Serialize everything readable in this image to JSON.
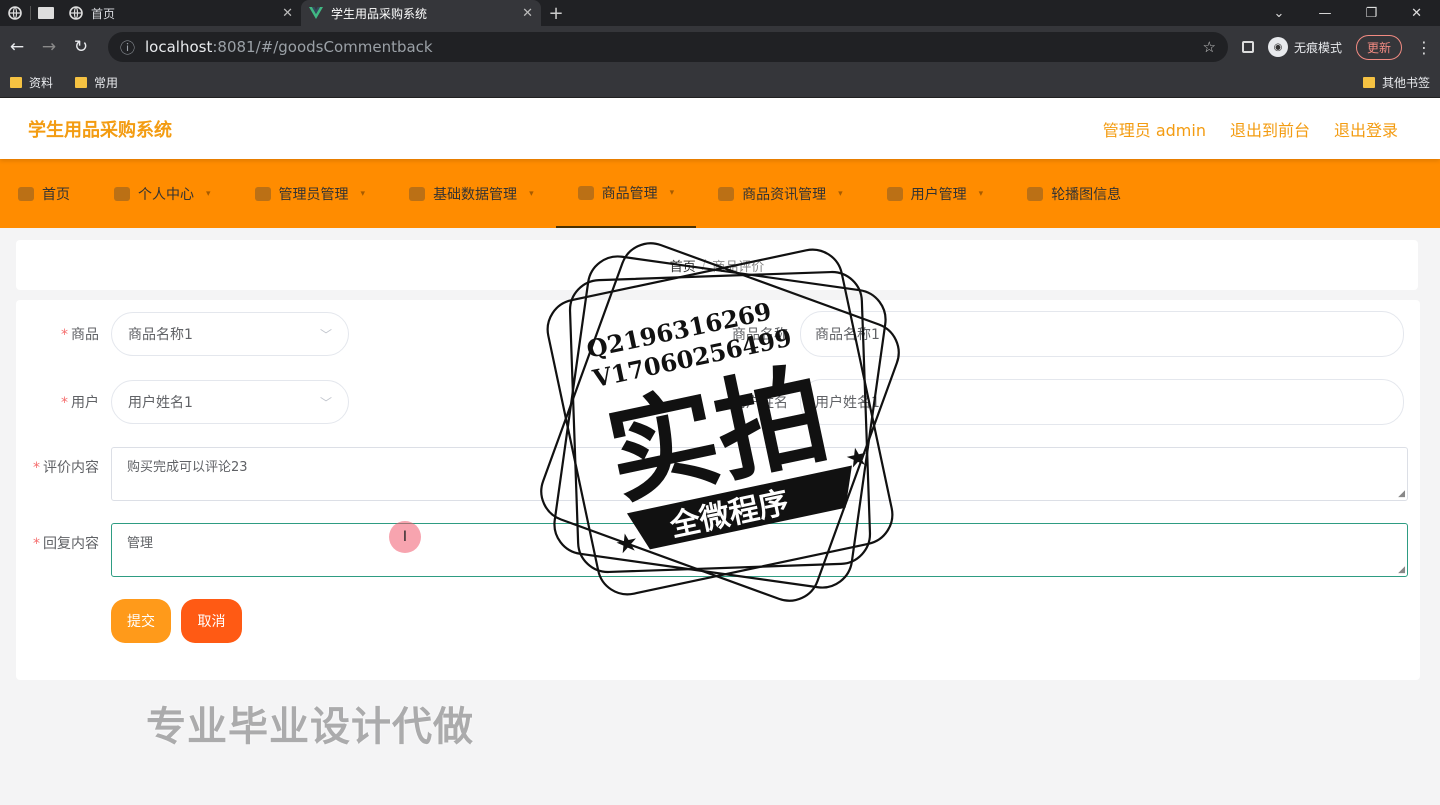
{
  "browser": {
    "tabs": [
      {
        "title": "首页",
        "active": false
      },
      {
        "title": "学生用品采购系统",
        "active": true
      }
    ],
    "url_host": "localhost",
    "url_rest": ":8081/#/goodsCommentback",
    "incognito_label": "无痕模式",
    "update_label": "更新",
    "bookmarks": [
      "资料",
      "常用"
    ],
    "other_bookmarks": "其他书签"
  },
  "header": {
    "title": "学生用品采购系统",
    "links": [
      "管理员 admin",
      "退出到前台",
      "退出登录"
    ],
    "accent_color": "#f39c12"
  },
  "menu": {
    "color": "#ff8c00",
    "items": [
      "首页",
      "个人中心",
      "管理员管理",
      "基础数据管理",
      "商品管理",
      "商品资讯管理",
      "用户管理",
      "轮播图信息"
    ],
    "active_index": 4
  },
  "breadcrumb": {
    "home": "首页",
    "separator": "/",
    "current": "商品评价"
  },
  "form": {
    "goods_label": "商品",
    "goods_value": "商品名称1",
    "goods_name_label": "商品名称",
    "goods_name_value": "商品名称1",
    "user_label": "用户",
    "user_value": "用户姓名1",
    "user_name_label": "用户姓名",
    "user_name_value": "用户姓名1",
    "comment_label": "评价内容",
    "comment_value": "购买完成可以评论23",
    "reply_label": "回复内容",
    "reply_value": "管理",
    "submit_label": "提交",
    "cancel_label": "取消"
  },
  "watermark": {
    "contact_q": "Q2196316269",
    "contact_v": "V17060256499",
    "big_text": "实拍",
    "ribbon_text": "全微程序",
    "bottom_text": "专业毕业设计代做"
  }
}
